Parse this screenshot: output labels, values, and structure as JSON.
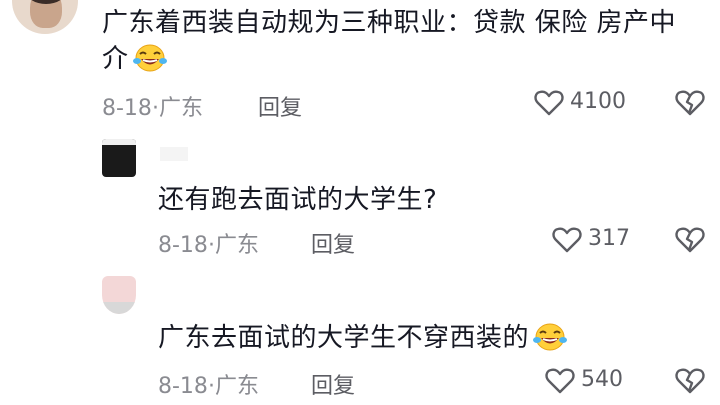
{
  "comments": [
    {
      "text": "广东着西装自动规为三种职业：贷款 保险 房产中介",
      "emoji": "laughing-crying-emoji",
      "date": "8-18",
      "location": "广东",
      "reply_label": "回复",
      "like_count": "4100"
    },
    {
      "text": "还有跑去面试的大学生?",
      "date": "8-18",
      "location": "广东",
      "reply_label": "回复",
      "like_count": "317"
    },
    {
      "text": "广东去面试的大学生不穿西装的",
      "emoji": "laughing-crying-emoji",
      "date": "8-18",
      "location": "广东",
      "reply_label": "回复",
      "like_count": "540"
    }
  ],
  "meta_separator": "·",
  "colors": {
    "text": "#161823",
    "meta": "#8a8b91",
    "icon": "#5c5d63",
    "background": "#ffffff"
  }
}
